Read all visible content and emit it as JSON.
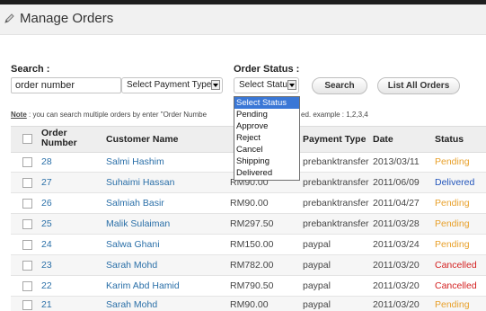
{
  "header": {
    "title": "Manage Orders"
  },
  "search": {
    "label": "Search :",
    "value": "order number",
    "payment_select": "Select Payment Type",
    "status_label": "Order Status :",
    "status_select": "Select Status",
    "search_button": "Search",
    "list_all_button": "List All Orders"
  },
  "note": {
    "prefix": "Note",
    "text": " : you can search multiple orders by enter \"Order Numbe",
    "text_tail": "ed. example : 1,2,3,4"
  },
  "status_dropdown": {
    "options": [
      "Select Status",
      "Pending",
      "Approve",
      "Reject",
      "Cancel",
      "Shipping",
      "Delivered"
    ],
    "selected": "Select Status"
  },
  "table": {
    "headers": {
      "order_number": "Order Number",
      "customer_name": "Customer Name",
      "payment_type": "Payment Type",
      "date": "Date",
      "status": "Status"
    },
    "rows": [
      {
        "order": "28",
        "customer": "Salmi Hashim",
        "amount": "",
        "payment": "prebanktransfer",
        "date": "2013/03/11",
        "status": "Pending"
      },
      {
        "order": "27",
        "customer": "Suhaimi Hassan",
        "amount": "RM90.00",
        "payment": "prebanktransfer",
        "date": "2011/06/09",
        "status": "Delivered"
      },
      {
        "order": "26",
        "customer": "Salmiah Basir",
        "amount": "RM90.00",
        "payment": "prebanktransfer",
        "date": "2011/04/27",
        "status": "Pending"
      },
      {
        "order": "25",
        "customer": "Malik Sulaiman",
        "amount": "RM297.50",
        "payment": "prebanktransfer",
        "date": "2011/03/28",
        "status": "Pending"
      },
      {
        "order": "24",
        "customer": "Salwa Ghani",
        "amount": "RM150.00",
        "payment": "paypal",
        "date": "2011/03/24",
        "status": "Pending"
      },
      {
        "order": "23",
        "customer": "Sarah Mohd",
        "amount": "RM782.00",
        "payment": "paypal",
        "date": "2011/03/20",
        "status": "Cancelled"
      },
      {
        "order": "22",
        "customer": "Karim Abd Hamid",
        "amount": "RM790.50",
        "payment": "paypal",
        "date": "2011/03/20",
        "status": "Cancelled"
      },
      {
        "order": "21",
        "customer": "Sarah Mohd",
        "amount": "RM90.00",
        "payment": "paypal",
        "date": "2011/03/20",
        "status": "Pending"
      }
    ]
  },
  "colors": {
    "link": "#2a6fa8",
    "pending": "#e8a02a",
    "delivered": "#2255bb",
    "cancelled": "#d42222",
    "dropdown_highlight": "#3a77d6"
  }
}
